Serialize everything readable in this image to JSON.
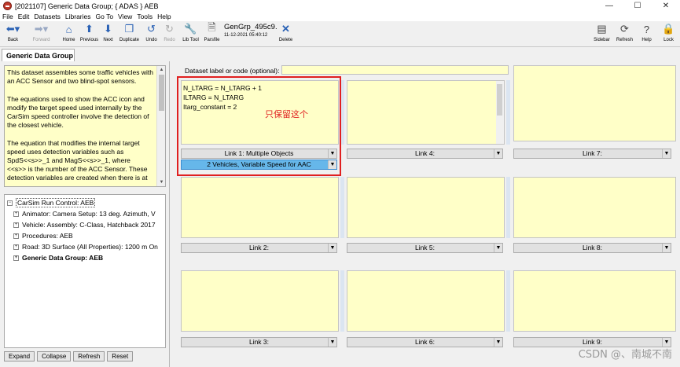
{
  "window": {
    "title": "[2021107] Generic Data Group; { ADAS } AEB",
    "minimize": "—",
    "maximize": "☐",
    "close": "✕"
  },
  "menu": [
    "File",
    "Edit",
    "Datasets",
    "Libraries",
    "Go To",
    "View",
    "Tools",
    "Help"
  ],
  "toolbar": {
    "back": "Back",
    "forward": "Forward",
    "home": "Home",
    "previous": "Previous",
    "next": "Next",
    "duplicate": "Duplicate",
    "undo": "Undo",
    "redo": "Redo",
    "lib_tool": "Lib Tool",
    "parsfile": "Parsfile",
    "dataset_name": "GenGrp_495c9.",
    "dataset_date": "11-12-2021 05:40:12",
    "delete": "Delete",
    "sidebar": "Sidebar",
    "refresh": "Refresh",
    "help": "Help",
    "lock": "Lock"
  },
  "tab": {
    "label": "Generic Data Group"
  },
  "left": {
    "description": "This dataset assembles some traffic vehicles with\nan ACC Sensor and two blind-spot sensors.\n\nThe equations used to show the ACC icon and\nmodify the target speed used internally by the\nCarSim speed controller involve the detection of\nthe closest vehicle.\n\nThe equation that modifies the internal target\nspeed uses detection variables such as\nSpdS<<s>>_1 and MagS<<s>>_1, where\n<<s>> is the number of the ACC Sensor. These\ndetection variables are created when there is at",
    "tree": {
      "root": "CarSim Run Control: AEB",
      "items": [
        "Animator: Camera Setup: 13 deg. Azimuth, V",
        "Vehicle: Assembly: C-Class, Hatchback 2017",
        "Procedures: AEB",
        "Road: 3D Surface (All Properties): 1200 m On",
        "Generic Data Group: AEB"
      ]
    },
    "buttons": [
      "Expand",
      "Collapse",
      "Refresh",
      "Reset"
    ]
  },
  "right": {
    "dataset_label": "Dataset label or code (optional):",
    "dataset_value": "",
    "cells": [
      {
        "text": "N_LTARG = N_LTARG + 1\nILTARG = N_LTARG\nItarg_constant = 2",
        "link": "Link 1: Multiple Objects",
        "link2": "2 Vehicles, Variable Speed for AAC"
      },
      {
        "text": "",
        "link": "Link 4:"
      },
      {
        "text": "",
        "link": "Link 7:"
      },
      {
        "text": "",
        "link": "Link 2:"
      },
      {
        "text": "",
        "link": "Link 5:"
      },
      {
        "text": "",
        "link": "Link 8:"
      },
      {
        "text": "",
        "link": "Link 3:"
      },
      {
        "text": "",
        "link": "Link 6:"
      },
      {
        "text": "",
        "link": "Link 9:"
      }
    ],
    "annotation": "只保留这个",
    "annotation_color": "#e02020"
  },
  "watermark": "CSDN @、南城不南"
}
